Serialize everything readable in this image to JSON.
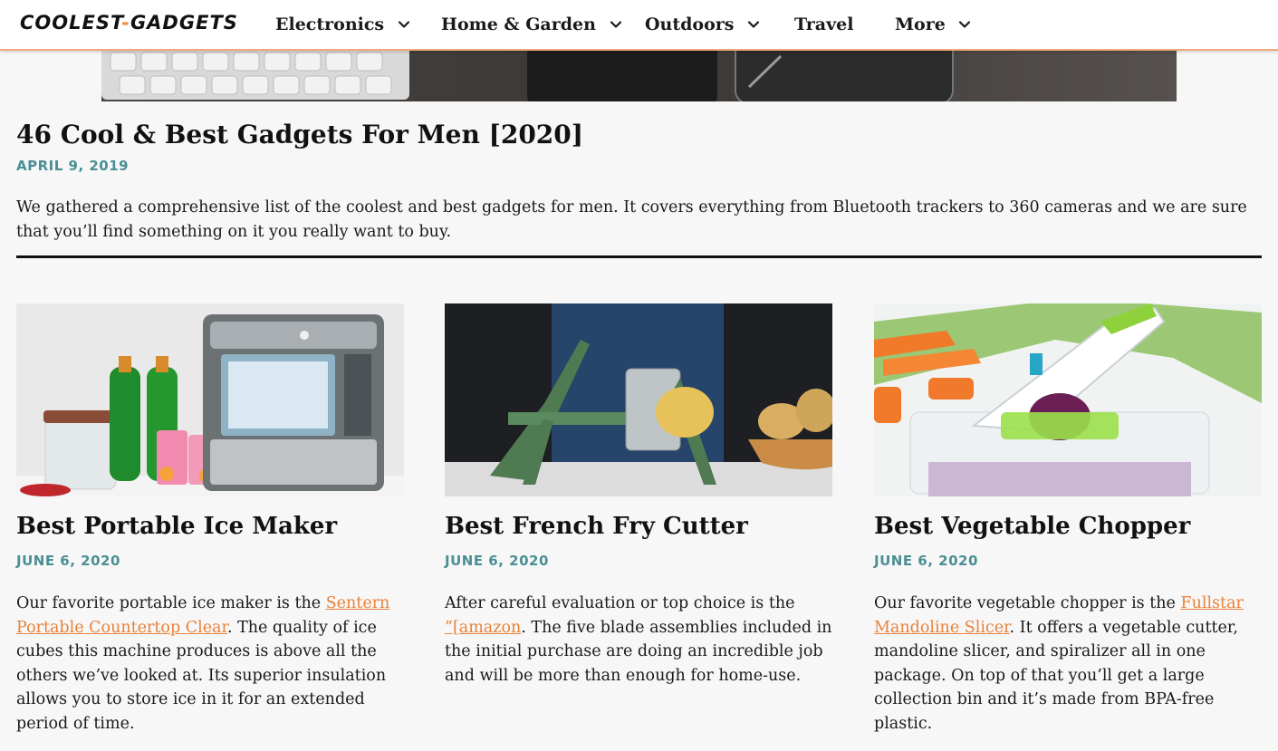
{
  "header": {
    "logo": {
      "part1": "COOLEST",
      "dash": "-",
      "part2": "GADGETS"
    },
    "nav": [
      {
        "label": "Electronics",
        "has_dropdown": true
      },
      {
        "label": "Home & Garden",
        "has_dropdown": true
      },
      {
        "label": "Outdoors",
        "has_dropdown": true
      },
      {
        "label": "Travel",
        "has_dropdown": false
      },
      {
        "label": "More",
        "has_dropdown": true
      }
    ]
  },
  "article": {
    "title": "46 Cool & Best Gadgets For Men [2020]",
    "date": "APRIL 9, 2019",
    "intro": "We gathered a comprehensive list of the coolest and best gadgets for men. It covers everything from Bluetooth trackers to 360 cameras and we are sure that you’ll find something on it you really want to buy."
  },
  "cards": [
    {
      "title": "Best Portable Ice Maker",
      "date": "JUNE 6, 2020",
      "desc_before": "Our favorite portable ice maker is the ",
      "link": "Sentern Portable Countertop Clear",
      "desc_after": ". The quality of ice cubes this machine produces is above all the others we’ve looked at. Its superior insulation allows you to store ice in it for an extended period of time."
    },
    {
      "title": "Best French Fry Cutter",
      "date": "JUNE 6, 2020",
      "desc_before": "After careful evaluation or top choice is the ",
      "link": "”[amazon",
      "desc_after": ". The five blade assemblies included in the initial purchase are doing an incredible job and will be more than enough for home-use."
    },
    {
      "title": "Best Vegetable Chopper",
      "date": "JUNE 6, 2020",
      "desc_before": "Our favorite vegetable chopper is the ",
      "link": "Fullstar Mandoline Slicer",
      "desc_after": ". It offers a vegetable cutter, mandoline slicer, and spiralizer all in one package. On top of that you’ll get a large collection bin and it’s made from BPA-free plastic."
    }
  ],
  "colors": {
    "accent_orange": "#e8823a",
    "date_teal": "#4a8f93",
    "header_border": "#f0a878"
  },
  "icons": {
    "dropdown": "chevron-down-icon"
  }
}
